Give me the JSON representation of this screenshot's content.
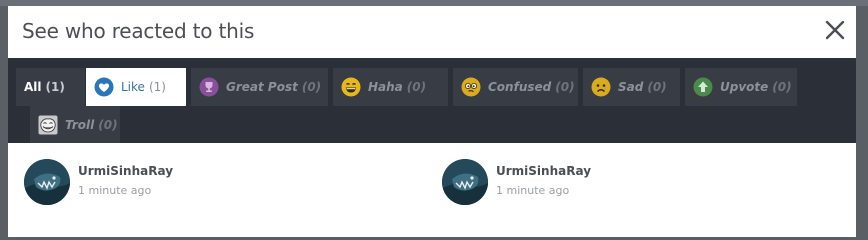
{
  "dialog": {
    "title": "See who reacted to this"
  },
  "tabs": [
    {
      "label": "All",
      "count": "(1)",
      "icon": "none"
    },
    {
      "label": "Like",
      "count": "(1)",
      "icon": "heart-icon"
    },
    {
      "label": "Great Post",
      "count": "(0)",
      "icon": "trophy-icon"
    },
    {
      "label": "Haha",
      "count": "(0)",
      "icon": "laughing-face-icon"
    },
    {
      "label": "Confused",
      "count": "(0)",
      "icon": "confused-face-icon"
    },
    {
      "label": "Sad",
      "count": "(0)",
      "icon": "sad-face-icon"
    },
    {
      "label": "Upvote",
      "count": "(0)",
      "icon": "up-arrow-icon"
    },
    {
      "label": "Troll",
      "count": "(0)",
      "icon": "troll-face-icon"
    }
  ],
  "active_tab": "Like",
  "reactors": [
    {
      "name": "UrmiSinhaRay",
      "time": "1 minute ago"
    },
    {
      "name": "UrmiSinhaRay",
      "time": "1 minute ago"
    }
  ],
  "colors": {
    "tab_bar": "#2b2f37",
    "tab_bg": "#383c45",
    "like_blue": "#2b76b6",
    "great_post_purple": "#8a4f9a",
    "haha_yellow": "#e5b81e",
    "upvote_green": "#4a8a4a"
  }
}
